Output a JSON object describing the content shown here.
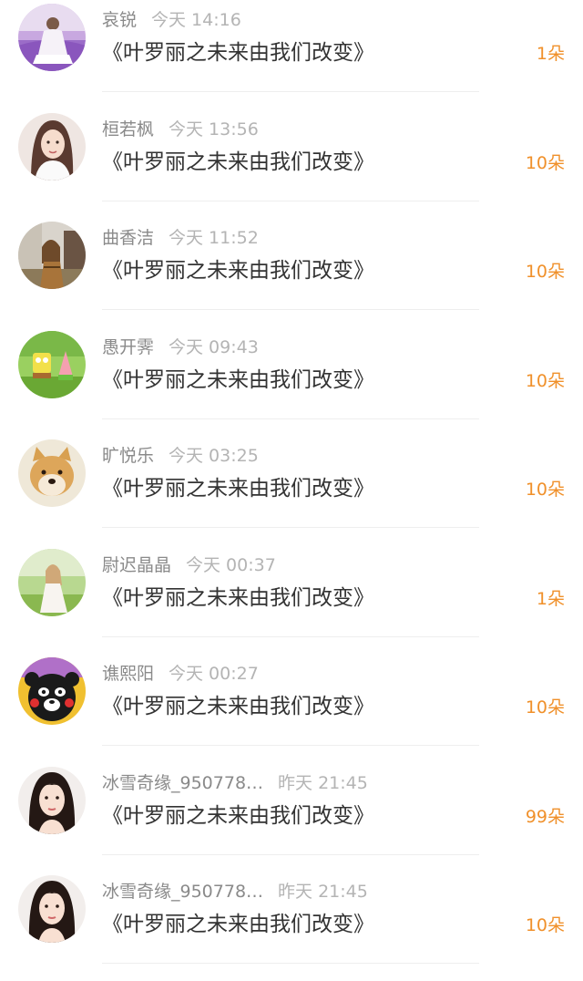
{
  "colors": {
    "accent": "#f0902a",
    "name": "#8a8a8a",
    "time": "#b4b4b4",
    "title": "#333333",
    "divider": "#eeeeee"
  },
  "items": [
    {
      "name": "哀锐",
      "time": "今天 14:16",
      "title": "《叶罗丽之未来由我们改变》",
      "gift": "1朵",
      "avatar": "lavender-field-photo"
    },
    {
      "name": "桓若枫",
      "time": "今天 13:56",
      "title": "《叶罗丽之未来由我们改变》",
      "gift": "10朵",
      "avatar": "woman-portrait-photo"
    },
    {
      "name": "曲香洁",
      "time": "今天 11:52",
      "title": "《叶罗丽之未来由我们改变》",
      "gift": "10朵",
      "avatar": "woman-outdoor-photo"
    },
    {
      "name": "愚开霁",
      "time": "今天 09:43",
      "title": "《叶罗丽之未来由我们改变》",
      "gift": "10朵",
      "avatar": "cartoon-characters-grass"
    },
    {
      "name": "旷悦乐",
      "time": "今天 03:25",
      "title": "《叶罗丽之未来由我们改变》",
      "gift": "10朵",
      "avatar": "shiba-dog-photo"
    },
    {
      "name": "尉迟晶晶",
      "time": "今天 00:37",
      "title": "《叶罗丽之未来由我们改变》",
      "gift": "1朵",
      "avatar": "girl-meadow-photo"
    },
    {
      "name": "谯熙阳",
      "time": "今天 00:27",
      "title": "《叶罗丽之未来由我们改变》",
      "gift": "10朵",
      "avatar": "black-bear-mascot"
    },
    {
      "name": "冰雪奇缘_950778…",
      "time": "昨天 21:45",
      "title": "《叶罗丽之未来由我们改变》",
      "gift": "99朵",
      "avatar": "actress-portrait-photo"
    },
    {
      "name": "冰雪奇缘_950778…",
      "time": "昨天 21:45",
      "title": "《叶罗丽之未来由我们改变》",
      "gift": "10朵",
      "avatar": "actress-portrait-photo"
    }
  ]
}
